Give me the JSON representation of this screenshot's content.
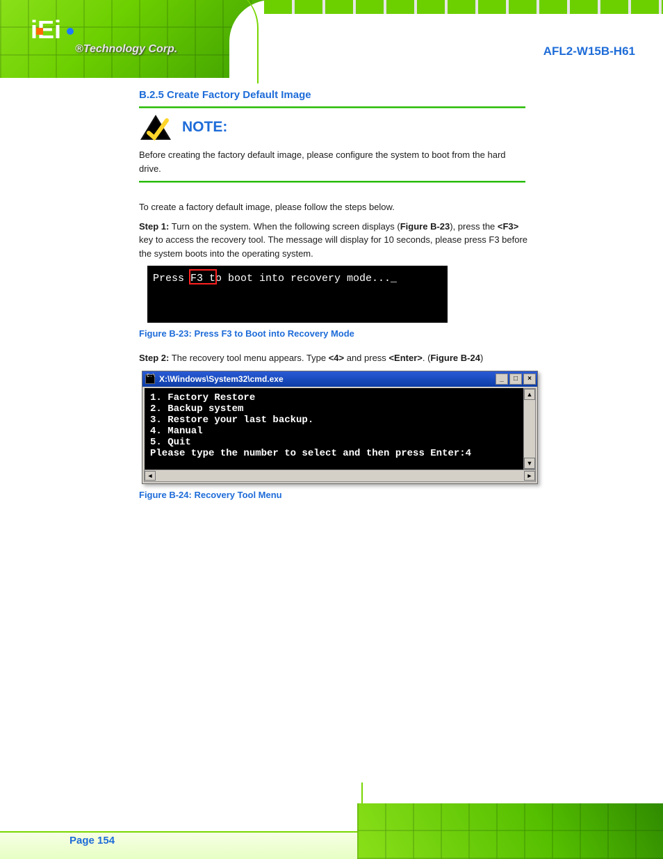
{
  "header": {
    "logo_text": "iEi",
    "tagline": "®Technology Corp.",
    "product": "AFL2-W15B-H61"
  },
  "section": {
    "heading": "B.2.5  Create Factory Default Image"
  },
  "note": {
    "label": "NOTE:",
    "text": "Before creating the factory default image, please configure the system to boot from the hard drive."
  },
  "intro": "To create a factory default image, please follow the steps below.",
  "steps": {
    "s1": {
      "prefix": "Step 1:",
      "text_a": "Turn on the system. When the following screen displays (",
      "fig_ref": "Figure B-23",
      "text_b": "), press the ",
      "key1": "<F3>",
      "text_c": " key to access the recovery tool. The message will display for 10 seconds, please press F3 before the system boots into the operating system."
    },
    "s2": {
      "prefix": "Step 2:",
      "text_a": "The recovery tool menu appears. Type ",
      "key1": "<4>",
      "text_b": " and press ",
      "key2": "<Enter>",
      "text_c": ". (",
      "fig_ref": "Figure B-24",
      "text_d": ")"
    }
  },
  "terminal1": {
    "text": "Press F3 to boot into recovery mode..._"
  },
  "fig1_caption": "Figure B-23: Press F3 to Boot into Recovery Mode",
  "cmdwin": {
    "title": "X:\\Windows\\System32\\cmd.exe",
    "lines": [
      "1. Factory Restore",
      "2. Backup system",
      "3. Restore your last backup.",
      "4. Manual",
      "5. Quit",
      "Please type the number to select and then press Enter:4"
    ],
    "min_label": "_",
    "max_label": "□",
    "close_label": "×",
    "arrow_up": "▲",
    "arrow_down": "▼",
    "arrow_left": "◄",
    "arrow_right": "►"
  },
  "fig2_caption": "Figure B-24: Recovery Tool Menu",
  "footer": {
    "page": "Page 154"
  }
}
